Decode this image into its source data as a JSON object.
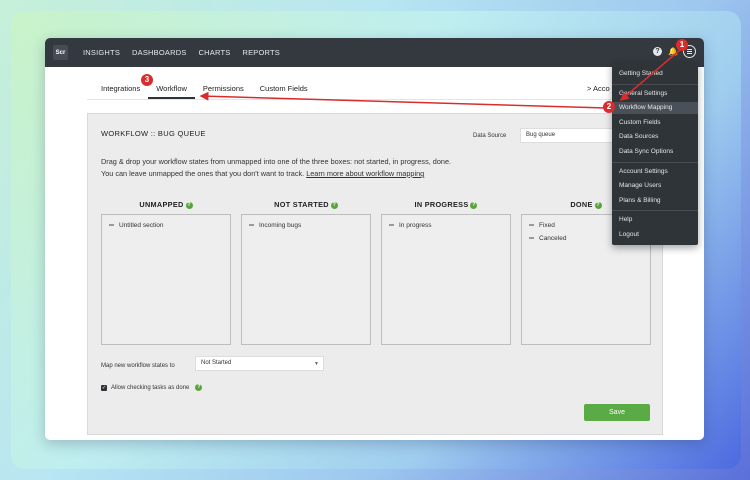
{
  "topbar": {
    "logo": "Scr",
    "nav": [
      "INSIGHTS",
      "DASHBOARDS",
      "CHARTS",
      "REPORTS"
    ]
  },
  "tabs": [
    "Integrations",
    "Workflow",
    "Permissions",
    "Custom Fields"
  ],
  "accounts_link": "> Acco",
  "panel": {
    "title": "WORKFLOW :: BUG QUEUE",
    "data_source_label": "Data Source",
    "data_source_value": "Bug queue",
    "description_line1": "Drag & drop your workflow states from unmapped into one of the three boxes: not started, in progress, done.",
    "description_line2": "You can leave unmapped the ones that you don't want to track.",
    "learn_more": "Learn more about workflow mapping",
    "columns": [
      {
        "title": "UNMAPPED",
        "items": [
          "Untitled section"
        ]
      },
      {
        "title": "NOT STARTED",
        "items": [
          "Incoming bugs"
        ]
      },
      {
        "title": "IN PROGRESS",
        "items": [
          "In progress"
        ]
      },
      {
        "title": "DONE",
        "items": [
          "Fixed",
          "Canceled"
        ]
      }
    ],
    "map_label": "Map new workflow states to",
    "map_value": "Not Started",
    "checkbox_label": "Allow checking tasks as done",
    "save": "Save"
  },
  "dropdown": {
    "items": [
      "Getting Started",
      "General Settings",
      "Workflow Mapping",
      "Custom Fields",
      "Data Sources",
      "Data Sync Options",
      "Account Settings",
      "Manage Users",
      "Plans & Billing",
      "Help",
      "Logout"
    ],
    "highlighted": "Workflow Mapping"
  },
  "annotations": [
    "1",
    "2",
    "3"
  ],
  "colors": {
    "accent": "#5aaa45",
    "annotation": "#d92d2d",
    "topbar": "#33393f"
  },
  "icons": [
    "help-icon",
    "bell-icon",
    "menu-icon",
    "checkbox-icon",
    "caret-down-icon"
  ]
}
